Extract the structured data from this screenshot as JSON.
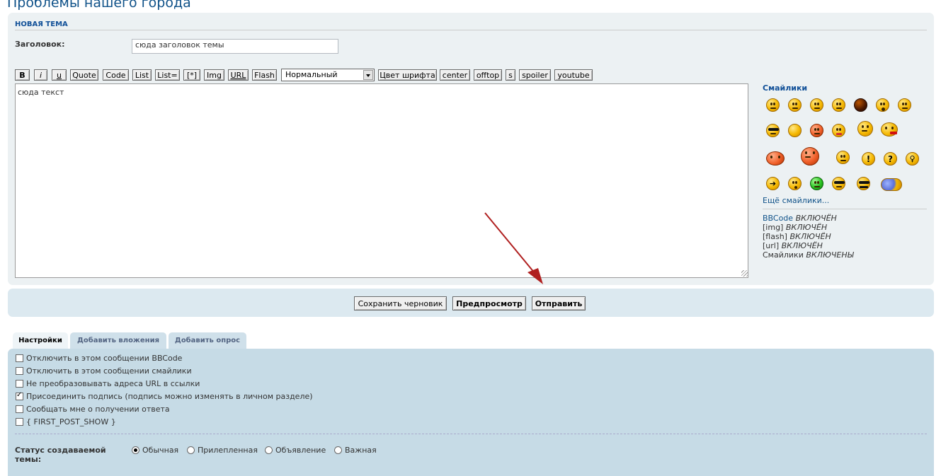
{
  "page": {
    "title": "Проблемы нашего города"
  },
  "post_form": {
    "heading": "НОВАЯ ТЕМА",
    "subject_label": "Заголовок:",
    "subject_value": "сюда заголовок темы",
    "message_value": "сюда текст"
  },
  "toolbar": {
    "bold": "B",
    "italic": "i",
    "underline": "u",
    "quote": "Quote",
    "code": "Code",
    "list": "List",
    "list_eq": "List=",
    "list_item": "[*]",
    "img": "Img",
    "url": "URL",
    "flash": "Flash",
    "font_size_selected": "Нормальный",
    "font_color": "Цвет шрифта",
    "center": "center",
    "offtop": "offtop",
    "strike": "s",
    "spoiler": "spoiler",
    "youtube": "youtube"
  },
  "smilies": {
    "title": "Смайлики",
    "more": "Ещё смайлики...",
    "icons": [
      "grin-smiley-icon",
      "smile-smiley-icon",
      "happy-smiley-icon",
      "sad-smiley-icon",
      "angry-dark-smiley-icon",
      "shocked-smiley-icon",
      "neutral-smiley-icon",
      "cool-sunglasses-smiley-icon",
      "blank-smiley-icon",
      "mad-red-smiley-icon",
      "tongue-smiley-icon",
      "thinking-smiley-icon",
      "kiss-smiley-icon",
      "crab-smiley-icon",
      "devil-smiley-icon",
      "wink-smiley-icon",
      "exclamation-smiley-icon",
      "question-smiley-icon",
      "idea-smiley-icon",
      "arrow-smiley-icon",
      "whistle-smiley-icon",
      "sick-green-smiley-icon",
      "sunglasses-smiley-icon",
      "mustache-smiley-icon",
      "group-smiley-icon"
    ]
  },
  "bbcode_status": {
    "bbcode_key": "BBCode",
    "bbcode_val": "ВКЛЮЧЁН",
    "img_key": "[img]",
    "img_val": "ВКЛЮЧЁН",
    "flash_key": "[flash]",
    "flash_val": "ВКЛЮЧЁН",
    "url_key": "[url]",
    "url_val": "ВКЛЮЧЁН",
    "smilies_key": "Смайлики",
    "smilies_val": "ВКЛЮЧЕНЫ"
  },
  "submit_buttons": {
    "save_draft": "Сохранить черновик",
    "preview": "Предпросмотр",
    "submit": "Отправить"
  },
  "tabs": {
    "settings": "Настройки",
    "attachments": "Добавить вложения",
    "poll": "Добавить опрос"
  },
  "options": [
    {
      "label": "Отключить в этом сообщении BBCode",
      "checked": false
    },
    {
      "label": "Отключить в этом сообщении смайлики",
      "checked": false
    },
    {
      "label": "Не преобразовывать адреса URL в ссылки",
      "checked": false
    },
    {
      "label": "Присоединить подпись (подпись можно изменять в личном разделе)",
      "checked": true
    },
    {
      "label": "Сообщать мне о получении ответа",
      "checked": false
    },
    {
      "label": "{ FIRST_POST_SHOW }",
      "checked": false
    }
  ],
  "topic_type": {
    "label": "Статус создаваемой темы:",
    "normal": "Обычная",
    "sticky": "Прилепленная",
    "announce": "Объявление",
    "important": "Важная",
    "selected": "Обычная"
  },
  "colors": {
    "accent": "#105289",
    "panel_bg": "#ecf1f3",
    "options_bg": "#c6dbe6",
    "annotation_arrow": "#b02020"
  }
}
